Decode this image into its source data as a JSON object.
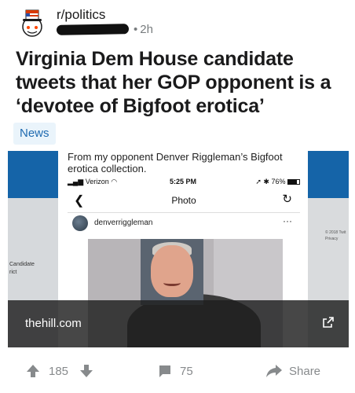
{
  "post": {
    "subreddit": "r/politics",
    "time": "2h",
    "title": "Virginia Dem House candidate tweets that her GOP opponent is a ‘devotee of Bigfoot erotica’",
    "flair": "News"
  },
  "preview": {
    "caption": "From my opponent Denver Riggleman’s Bigfoot erotica collection.",
    "status": {
      "carrier": "Verizon",
      "time": "5:25 PM",
      "battery": "76%"
    },
    "nav_title": "Photo",
    "username": "denverriggleman",
    "more": "···",
    "left_side_text": "Candidate\nrict",
    "right_side_text": "© 2018 Twit\nPrivacy",
    "domain": "thehill.com"
  },
  "actions": {
    "score": "185",
    "comments": "75",
    "share_label": "Share"
  },
  "colors": {
    "flair_bg": "#eaf4fb",
    "flair_text": "#1f6ab0",
    "meta_gray": "#787c7e",
    "action_gray": "#878a8c"
  }
}
